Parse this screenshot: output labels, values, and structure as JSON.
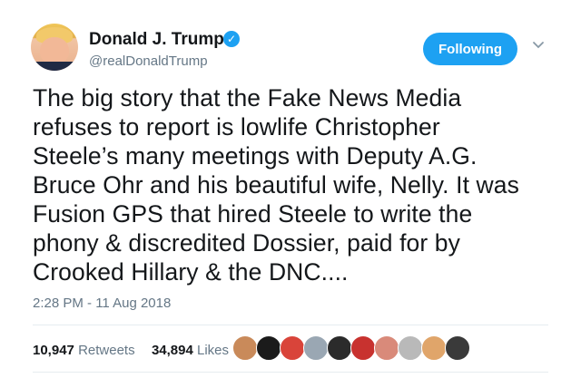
{
  "author": {
    "name": "Donald J. Trump",
    "handle": "@realDonaldTrump",
    "verified_glyph": "✓"
  },
  "follow_button": {
    "label": "Following"
  },
  "menu": {
    "chevron_glyph": "⌄"
  },
  "tweet_lines": [
    "The big story that the Fake News Media",
    "refuses to report is lowlife Christopher",
    "Steele’s many meetings with Deputy A.G.",
    "Bruce Ohr and his beautiful wife, Nelly. It was",
    "Fusion GPS that hired Steele to write the",
    "phony & discredited Dossier, paid for by",
    "Crooked Hillary & the DNC...."
  ],
  "timestamp": "2:28 PM - 11 Aug 2018",
  "stats": {
    "retweets_count": "10,947",
    "retweets_label": "Retweets",
    "likes_count": "34,894",
    "likes_label": "Likes"
  },
  "liker_avatars": [
    {
      "name": "liker-avatar-1",
      "color": "#c98a5a"
    },
    {
      "name": "liker-avatar-2",
      "color": "#1b1b1b"
    },
    {
      "name": "liker-avatar-3",
      "color": "#d9443a"
    },
    {
      "name": "liker-avatar-4",
      "color": "#9aa7b3"
    },
    {
      "name": "liker-avatar-5",
      "color": "#2b2b2b"
    },
    {
      "name": "liker-avatar-6",
      "color": "#c8322f"
    },
    {
      "name": "liker-avatar-7",
      "color": "#d98a7a"
    },
    {
      "name": "liker-avatar-8",
      "color": "#b9b9b9"
    },
    {
      "name": "liker-avatar-9",
      "color": "#e0a56a"
    },
    {
      "name": "liker-avatar-10",
      "color": "#3a3a3a"
    }
  ],
  "colors": {
    "accent": "#1da1f2",
    "muted": "#657786",
    "text": "#14171a"
  }
}
